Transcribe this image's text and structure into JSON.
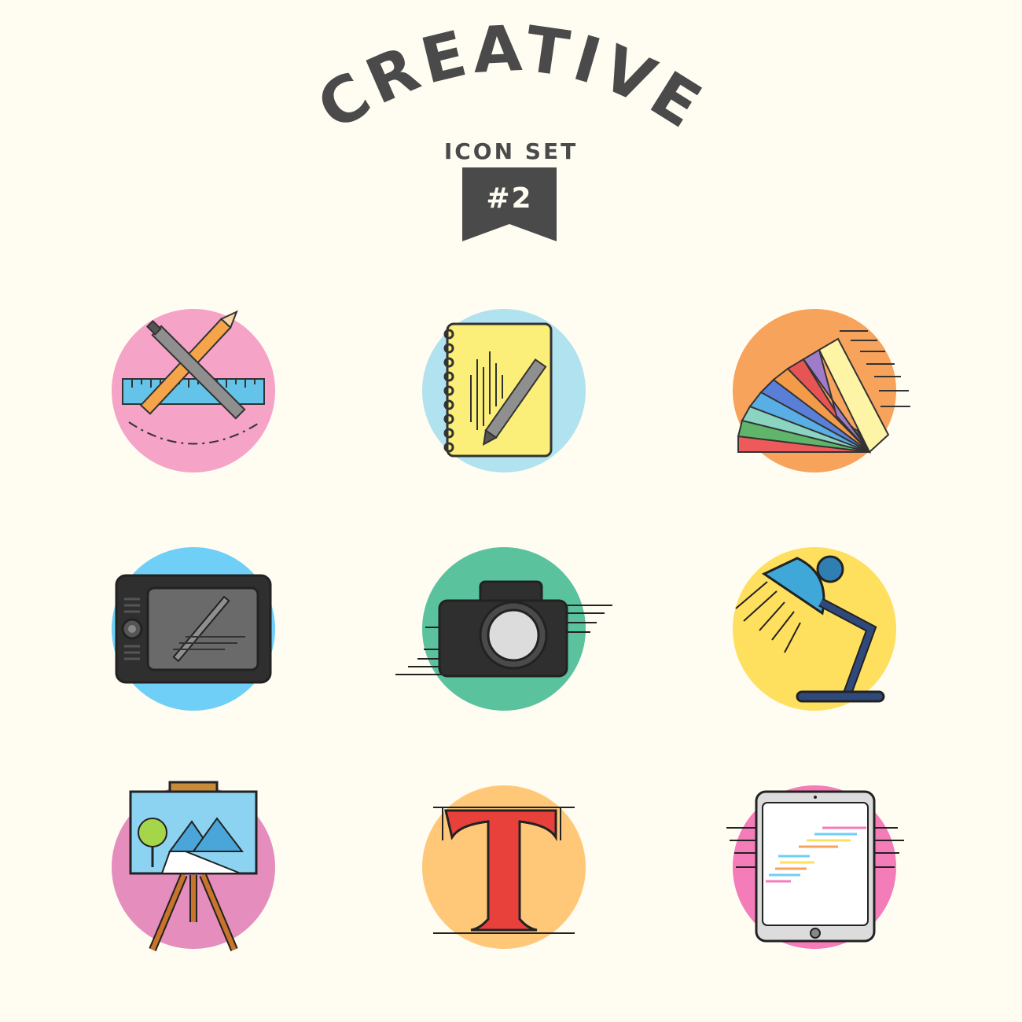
{
  "header": {
    "title": "CREATIVE",
    "subtitle": "ICON SET",
    "badge": "#2"
  },
  "colors": {
    "background": "#fffdf2",
    "ink": "#4a4a4a",
    "pink": "#f5a3c7",
    "light_blue": "#b1e2ef",
    "orange": "#f7a35c",
    "sky_blue": "#6fcff7",
    "green": "#5bc29e",
    "yellow": "#ffdf5e",
    "magenta": "#e58dbd",
    "peach": "#ffc878",
    "hot_pink": "#f47cb8"
  },
  "icons": [
    {
      "name": "ruler-pencil-pen-icon"
    },
    {
      "name": "sketchbook-pen-icon"
    },
    {
      "name": "color-swatch-fan-icon"
    },
    {
      "name": "graphics-tablet-icon"
    },
    {
      "name": "camera-icon"
    },
    {
      "name": "desk-lamp-icon"
    },
    {
      "name": "easel-painting-icon"
    },
    {
      "name": "typography-t-icon"
    },
    {
      "name": "tablet-code-icon"
    }
  ]
}
